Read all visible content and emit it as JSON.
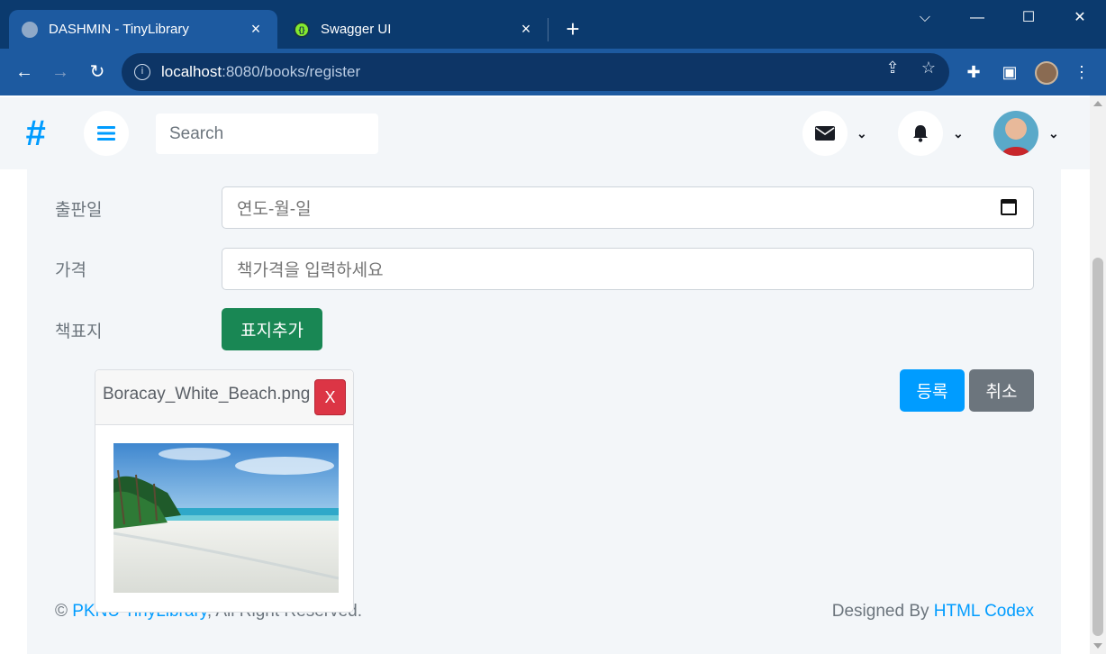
{
  "browser": {
    "tabs": [
      {
        "title": "DASHMIN - TinyLibrary",
        "active": true,
        "icon": "globe-icon"
      },
      {
        "title": "Swagger UI",
        "active": false,
        "icon": "swagger-icon"
      }
    ],
    "close_glyph": "×",
    "new_tab_glyph": "+",
    "url_host": "localhost",
    "url_path": ":8080/books/register"
  },
  "topnav": {
    "logo": "#",
    "search_placeholder": "Search"
  },
  "form": {
    "publish_date_label": "출판일",
    "publish_date_placeholder": "연도-월-일",
    "price_label": "가격",
    "price_placeholder": "책가격을 입력하세요",
    "cover_label": "책표지",
    "add_cover_button": "표지추가",
    "file_name": "Boracay_White_Beach.png",
    "remove_file_button": "X",
    "register_button": "등록",
    "cancel_button": "취소"
  },
  "footer": {
    "copyright_prefix": "© ",
    "copyright_link": "PKNU TinyLibrary",
    "copyright_suffix": ", All Right Reserved.",
    "designed_by": "Designed By ",
    "designer_link": "HTML Codex"
  },
  "colors": {
    "primary": "#009cff",
    "success": "#198754",
    "danger": "#dc3545",
    "secondary": "#6c757d",
    "page_bg": "#f3f6f9"
  }
}
